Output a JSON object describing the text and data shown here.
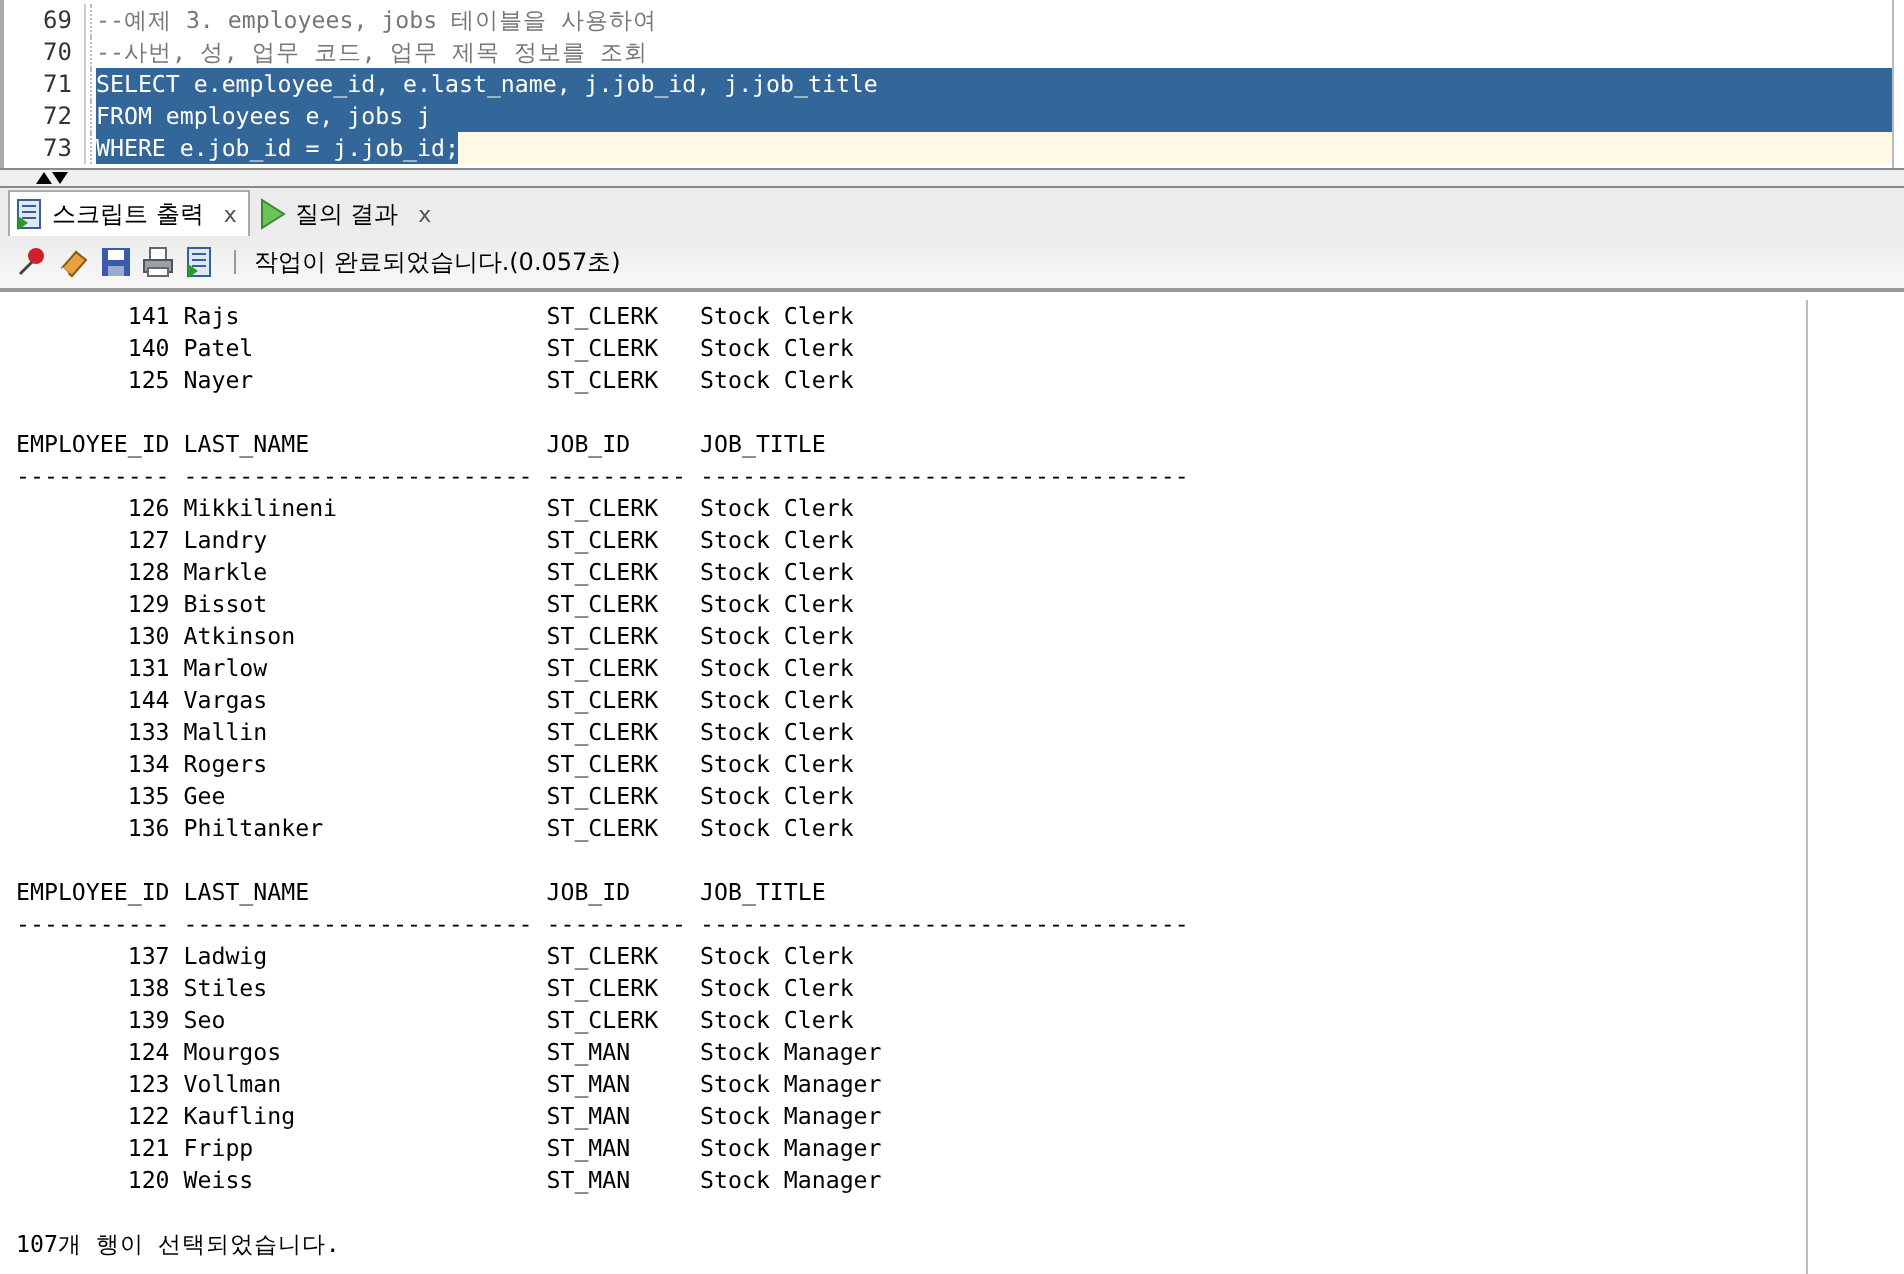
{
  "editor": {
    "lines": [
      {
        "number": "69",
        "text": "--예제 3. employees, jobs 테이블을 사용하여",
        "comment": true,
        "selected": false,
        "current": false
      },
      {
        "number": "70",
        "text": "--사번, 성, 업무 코드, 업무 제목 정보를 조회",
        "comment": true,
        "selected": false,
        "current": false
      },
      {
        "number": "71",
        "text": "SELECT e.employee_id, e.last_name, j.job_id, j.job_title",
        "selected": true,
        "current": false
      },
      {
        "number": "72",
        "text": "FROM employees e, jobs j",
        "selected": true,
        "current": false
      },
      {
        "number": "73",
        "text": "WHERE e.job_id = j.job_id;",
        "selected": true,
        "current": true
      }
    ]
  },
  "tabs": [
    {
      "label": "스크립트 출력",
      "selected": true,
      "close": "x"
    },
    {
      "label": "질의 결과",
      "selected": false,
      "close": "x"
    }
  ],
  "toolbar": {
    "status": "작업이 완료되었습니다.(0.057초)"
  },
  "output": {
    "lines": [
      {
        "kind": "text",
        "text": "        141 Rajs                      ST_CLERK   Stock Clerk"
      },
      {
        "kind": "text",
        "text": "        140 Patel                     ST_CLERK   Stock Clerk"
      },
      {
        "kind": "text",
        "text": "        125 Nayer                     ST_CLERK   Stock Clerk"
      },
      {
        "kind": "blank"
      },
      {
        "kind": "text",
        "text": "EMPLOYEE_ID LAST_NAME                 JOB_ID     JOB_TITLE"
      },
      {
        "kind": "text",
        "text": "----------- ------------------------- ---------- -----------------------------------"
      },
      {
        "kind": "text",
        "text": "        126 Mikkilineni               ST_CLERK   Stock Clerk"
      },
      {
        "kind": "text",
        "text": "        127 Landry                    ST_CLERK   Stock Clerk"
      },
      {
        "kind": "text",
        "text": "        128 Markle                    ST_CLERK   Stock Clerk"
      },
      {
        "kind": "text",
        "text": "        129 Bissot                    ST_CLERK   Stock Clerk"
      },
      {
        "kind": "text",
        "text": "        130 Atkinson                  ST_CLERK   Stock Clerk"
      },
      {
        "kind": "text",
        "text": "        131 Marlow                    ST_CLERK   Stock Clerk"
      },
      {
        "kind": "text",
        "text": "        144 Vargas                    ST_CLERK   Stock Clerk"
      },
      {
        "kind": "text",
        "text": "        133 Mallin                    ST_CLERK   Stock Clerk"
      },
      {
        "kind": "text",
        "text": "        134 Rogers                    ST_CLERK   Stock Clerk"
      },
      {
        "kind": "text",
        "text": "        135 Gee                       ST_CLERK   Stock Clerk"
      },
      {
        "kind": "text",
        "text": "        136 Philtanker                ST_CLERK   Stock Clerk"
      },
      {
        "kind": "blank"
      },
      {
        "kind": "text",
        "text": "EMPLOYEE_ID LAST_NAME                 JOB_ID     JOB_TITLE"
      },
      {
        "kind": "text",
        "text": "----------- ------------------------- ---------- -----------------------------------"
      },
      {
        "kind": "text",
        "text": "        137 Ladwig                    ST_CLERK   Stock Clerk"
      },
      {
        "kind": "text",
        "text": "        138 Stiles                    ST_CLERK   Stock Clerk"
      },
      {
        "kind": "text",
        "text": "        139 Seo                       ST_CLERK   Stock Clerk"
      },
      {
        "kind": "text",
        "text": "        124 Mourgos                   ST_MAN     Stock Manager"
      },
      {
        "kind": "text",
        "text": "        123 Vollman                   ST_MAN     Stock Manager"
      },
      {
        "kind": "text",
        "text": "        122 Kaufling                  ST_MAN     Stock Manager"
      },
      {
        "kind": "text",
        "text": "        121 Fripp                     ST_MAN     Stock Manager"
      },
      {
        "kind": "text",
        "text": "        120 Weiss                     ST_MAN     Stock Manager"
      },
      {
        "kind": "blank"
      },
      {
        "kind": "text",
        "text": "107개 행이 선택되었습니다."
      }
    ]
  }
}
